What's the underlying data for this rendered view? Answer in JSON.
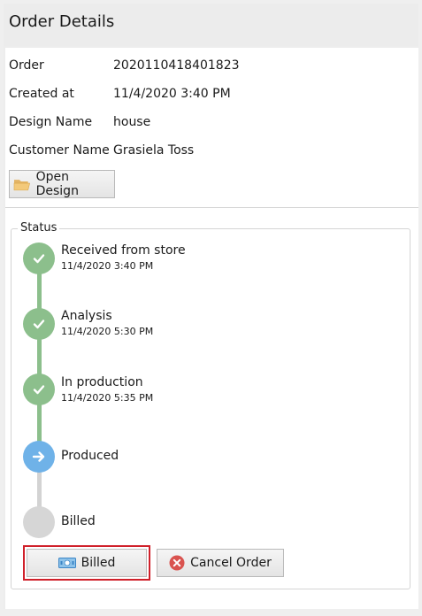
{
  "header": {
    "title": "Order Details"
  },
  "order": {
    "order_label": "Order",
    "order_value": "2020110418401823",
    "created_label": "Created at",
    "created_value": "11/4/2020 3:40 PM",
    "design_label": "Design Name",
    "design_value": "house",
    "customer_label": "Customer Name",
    "customer_value": "Grasiela Toss"
  },
  "actions": {
    "open_design": "Open Design",
    "billed": "Billed",
    "cancel_order": "Cancel Order"
  },
  "status": {
    "group_title": "Status",
    "steps": [
      {
        "name": "Received from store",
        "time": "11/4/2020 3:40 PM",
        "state": "done"
      },
      {
        "name": "Analysis",
        "time": "11/4/2020 5:30 PM",
        "state": "done"
      },
      {
        "name": "In production",
        "time": "11/4/2020 5:35 PM",
        "state": "done"
      },
      {
        "name": "Produced",
        "time": "",
        "state": "current"
      },
      {
        "name": "Billed",
        "time": "",
        "state": "pending"
      }
    ]
  },
  "colors": {
    "done": "#8cbf8c",
    "current": "#6fb2e8",
    "pending": "#d6d6d6",
    "highlight": "#d0202a",
    "cancel_icon": "#d9534f"
  },
  "icons": {
    "open_design": "folder-open-icon",
    "billed": "money-bill-icon",
    "cancel_order": "cancel-circle-icon",
    "done_step": "check-icon",
    "current_step": "arrow-right-icon"
  }
}
